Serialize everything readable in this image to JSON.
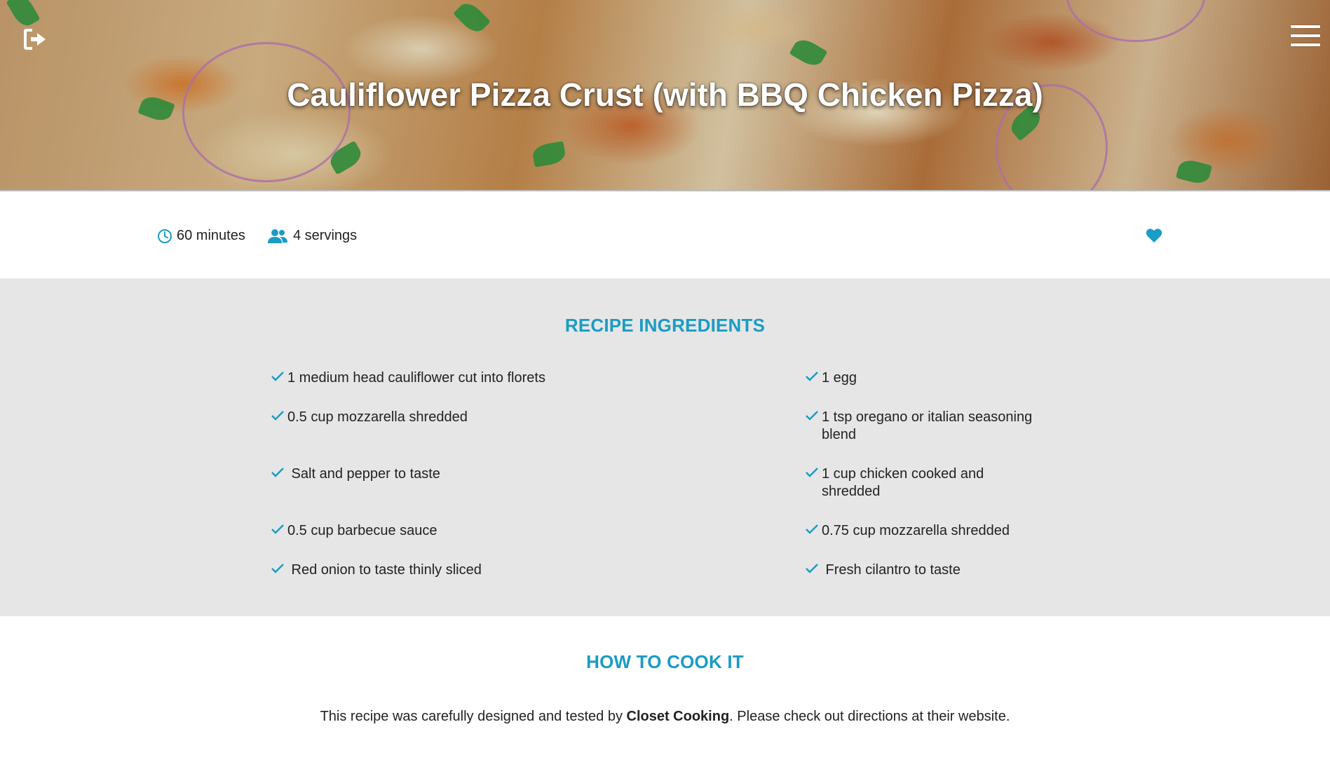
{
  "header": {
    "title": "Cauliflower Pizza Crust (with BBQ Chicken Pizza)"
  },
  "meta": {
    "time": "60 minutes",
    "servings": "4 servings"
  },
  "ingredients": {
    "title": "RECIPE INGREDIENTS",
    "left": [
      "1 medium head cauliflower cut into florets",
      "0.5 cup mozzarella shredded",
      " Salt and pepper to taste",
      "0.5 cup barbecue sauce",
      " Red onion to taste thinly sliced"
    ],
    "right": [
      "1 egg",
      "1 tsp oregano or italian seasoning blend",
      "1 cup chicken cooked and shredded",
      "0.75 cup mozzarella shredded",
      " Fresh cilantro to taste"
    ]
  },
  "cook": {
    "title": "HOW TO COOK IT",
    "text_before": "This recipe was carefully designed and tested by ",
    "source": "Closet Cooking",
    "text_after": ". Please check out directions at their website."
  },
  "colors": {
    "accent": "#1a9cc4",
    "section_bg": "#e6e6e6"
  }
}
